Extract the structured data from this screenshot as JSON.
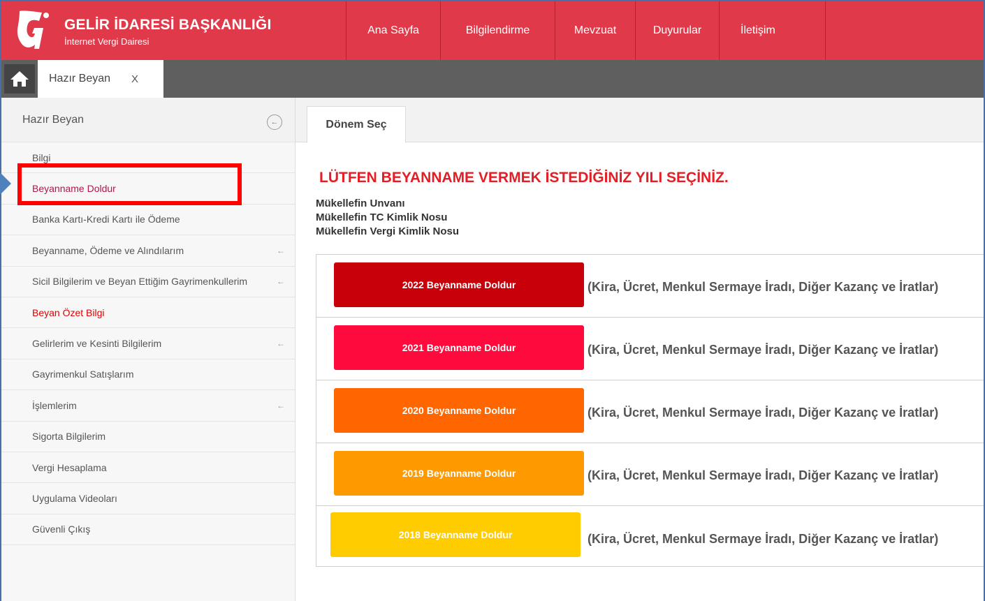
{
  "header": {
    "title": "GELİR İDARESİ BAŞKANLIĞI",
    "subtitle": "İnternet Vergi Dairesi",
    "brand_color": "#e03a4a",
    "nav": [
      {
        "label": "Ana Sayfa"
      },
      {
        "label": "Bilgilendirme"
      },
      {
        "label": "Mevzuat"
      },
      {
        "label": "Duyurular"
      },
      {
        "label": "İletişim"
      }
    ]
  },
  "tabs": {
    "home_icon": "home-icon",
    "open_tab": {
      "label": "Hazır Beyan",
      "close_label": "X"
    }
  },
  "sidebar": {
    "title": "Hazır Beyan",
    "collapse_symbol": "←",
    "items": [
      {
        "label": "Bilgi"
      },
      {
        "label": "Beyanname Doldur",
        "state": "active"
      },
      {
        "label": "Banka Kartı-Kredi Kartı ile Ödeme"
      },
      {
        "label": "Beyanname, Ödeme ve Alındılarım",
        "arrow": "←"
      },
      {
        "label": "Sicil Bilgilerim ve Beyan Ettiğim Gayrimenkullerim",
        "arrow": "←"
      },
      {
        "label": "Beyan Özet Bilgi",
        "state": "highlight"
      },
      {
        "label": "Gelirlerim ve Kesinti Bilgilerim",
        "arrow": "←"
      },
      {
        "label": "Gayrimenkul Satışlarım"
      },
      {
        "label": "İşlemlerim",
        "arrow": "←"
      },
      {
        "label": "Sigorta Bilgilerim"
      },
      {
        "label": "Vergi Hesaplama"
      },
      {
        "label": "Uygulama Videoları"
      },
      {
        "label": "Güvenli Çıkış"
      }
    ]
  },
  "main": {
    "tab_label": "Dönem Seç",
    "heading": "LÜTFEN BEYANNAME VERMEK İSTEDİĞİNİZ YILI SEÇİNİZ.",
    "info": {
      "unvan": "Mükellefin Unvanı",
      "tc": "Mükellefin TC Kimlik Nosu",
      "vkn": "Mükellefin Vergi Kimlik Nosu"
    },
    "years": [
      {
        "button": "2022 Beyanname Doldur",
        "color": "#c8000a",
        "desc": "(Kira, Ücret, Menkul Sermaye İradı, Diğer Kazanç ve İratlar)"
      },
      {
        "button": "2021 Beyanname Doldur",
        "color": "#ff0a3c",
        "desc": "(Kira, Ücret, Menkul Sermaye İradı, Diğer Kazanç ve İratlar)"
      },
      {
        "button": "2020 Beyanname Doldur",
        "color": "#ff6600",
        "desc": "(Kira, Ücret, Menkul Sermaye İradı, Diğer Kazanç ve İratlar)"
      },
      {
        "button": "2019 Beyanname Doldur",
        "color": "#ff9900",
        "desc": "(Kira, Ücret, Menkul Sermaye İradı, Diğer Kazanç ve İratlar)"
      },
      {
        "button": "2018 Beyanname Doldur",
        "color": "#ffcc00",
        "desc": "(Kira, Ücret, Menkul Sermaye İradı, Diğer Kazanç ve İratlar)"
      }
    ]
  }
}
